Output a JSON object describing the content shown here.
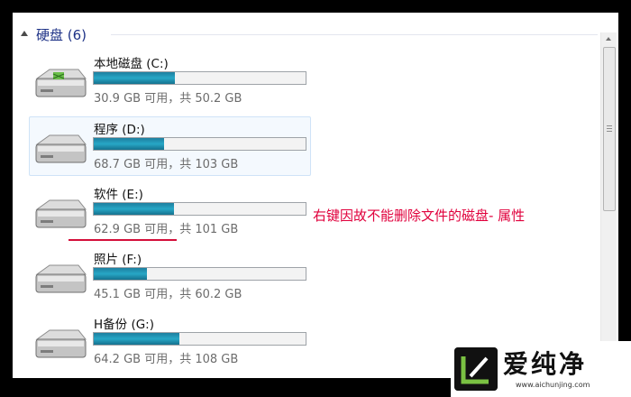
{
  "group": {
    "title": "硬盘 (6)"
  },
  "drives": [
    {
      "name": "本地磁盘 (C:)",
      "space": "30.9 GB 可用，共 50.2 GB",
      "used_fraction": 0.385,
      "selected": false
    },
    {
      "name": "程序 (D:)",
      "space": "68.7 GB 可用，共 103 GB",
      "used_fraction": 0.333,
      "selected": true
    },
    {
      "name": "软件 (E:)",
      "space": "62.9 GB 可用，共 101 GB",
      "used_fraction": 0.377,
      "selected": false
    },
    {
      "name": "照片 (F:)",
      "space": "45.1 GB 可用，共 60.2 GB",
      "used_fraction": 0.251,
      "selected": false
    },
    {
      "name": "H备份 (G:)",
      "space": "64.2 GB 可用，共 108 GB",
      "used_fraction": 0.406,
      "selected": false
    }
  ],
  "annotation": {
    "text": "右键因故不能删除文件的磁盘- 属性"
  },
  "watermark": {
    "title": "爱纯净",
    "url": "www.aichunjing.com"
  },
  "colors": {
    "bar_fill": "#1e8fb0",
    "annotation_red": "#e0003c",
    "group_title": "#1e3287"
  }
}
